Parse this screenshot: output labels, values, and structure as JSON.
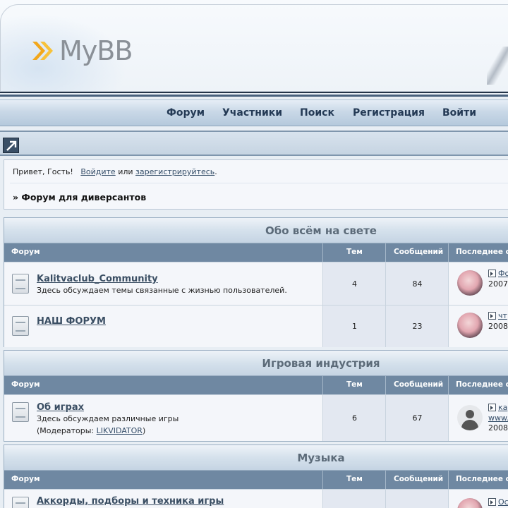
{
  "header": {
    "logo_text": "MyBB"
  },
  "nav": {
    "items": [
      "Форум",
      "Участники",
      "Поиск",
      "Регистрация",
      "Войти"
    ]
  },
  "welcome": {
    "greeting": "Привет, Гость!",
    "login_link": "Войдите",
    "or": "или",
    "register_link": "зарегистрируйтесь",
    "period": "."
  },
  "breadcrumb": "» Форум для диверсантов",
  "columns": {
    "forum": "Форум",
    "topics": "Тем",
    "posts": "Сообщений",
    "last": "Последнее со"
  },
  "categories": [
    {
      "title": "Обо всём на свете",
      "forums": [
        {
          "name": "Kalitvaclub_Community",
          "desc": "Здесь обсуждаем темы связанные с жизнью пользователей.",
          "topics": "4",
          "posts": "84",
          "last_link": "Фо",
          "last_date": "2007",
          "avatar": "anime-avatar"
        },
        {
          "name": "НАШ ФОРУМ",
          "desc": "",
          "topics": "1",
          "posts": "23",
          "last_link": "чт",
          "last_date": "2008",
          "avatar": "anime-avatar"
        }
      ]
    },
    {
      "title": "Игровая индустрия",
      "forums": [
        {
          "name": "Об играх",
          "desc": "Здесь обсуждаем различные игры",
          "mods_prefix": "(Модераторы: ",
          "mods_name": "LIKVIDATOR",
          "mods_suffix": ")",
          "topics": "6",
          "posts": "67",
          "last_link": "ка",
          "last_link2": "www.",
          "last_date": "2008",
          "avatar": "default-user-icon"
        }
      ]
    },
    {
      "title": "Музыка",
      "forums": [
        {
          "name": "Аккорды, подборы и техника игры",
          "desc": "",
          "topics": "",
          "posts": "",
          "last_link": "Ос",
          "last_date": "",
          "avatar": "anime-avatar"
        }
      ]
    }
  ],
  "colors": {
    "nav_text": "#243a55",
    "column_header_bg": "#6f88a2",
    "link": "#344d68"
  }
}
